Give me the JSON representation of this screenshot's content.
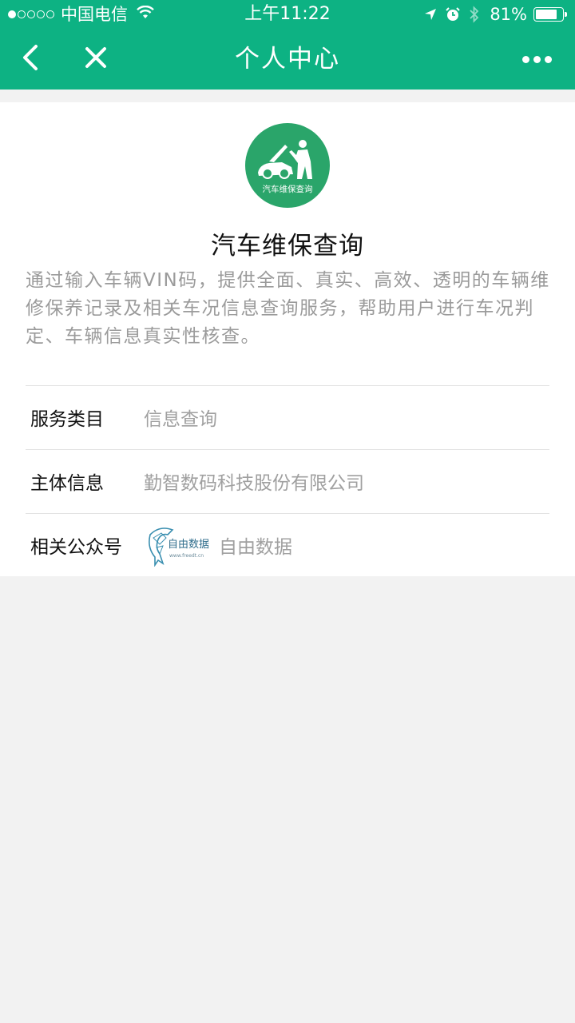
{
  "status_bar": {
    "carrier": "中国电信",
    "time": "上午11:22",
    "battery_percent": "81%",
    "battery_level": 0.81,
    "signal_bars_on": 1,
    "signal_bars_total": 5
  },
  "nav": {
    "title": "个人中心",
    "back_icon": "chevron-left-icon",
    "close_icon": "close-icon",
    "more_icon": "more-dots-icon",
    "bar_color": "#0db283"
  },
  "app": {
    "logo_text": "汽车维保查询",
    "logo_color": "#2aa56a",
    "name": "汽车维保查询",
    "description": "通过输入车辆VIN码，提供全面、真实、高效、透明的车辆维修保养记录及相关车况信息查询服务，帮助用户进行车况判定、车辆信息真实性核查。"
  },
  "info": {
    "category_label": "服务类目",
    "category_value": "信息查询",
    "entity_label": "主体信息",
    "entity_value": "勤智数码科技股份有限公司",
    "account_label": "相关公众号",
    "account_logo_text": "自由数据",
    "account_logo_url_text": "www.freedt.cn",
    "account_name": "自由数据"
  }
}
